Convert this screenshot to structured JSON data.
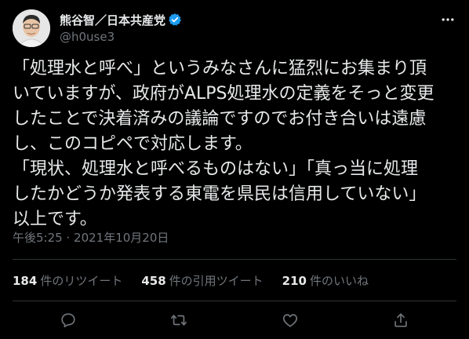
{
  "user": {
    "display_name": "熊谷智／日本共産党",
    "handle": "@h0use3"
  },
  "tweet": {
    "lines": [
      "「処理水と呼べ」というみなさんに猛烈にお集まり頂",
      "いていますが、政府がALPS処理水の定義をそっと変更",
      "したことで決着済みの議論ですのでお付き合いは遠慮",
      "し、このコピペで対応します。",
      "「現状、処理水と呼べるものはない」「真っ当に処理",
      "したかどうか発表する東電を県民は信用していない」",
      "以上です。"
    ],
    "time": "午後5:25",
    "separator": "·",
    "date": "2021年10月20日"
  },
  "stats": {
    "retweets_count": "184",
    "retweets_label": "件のリツイート",
    "quotes_count": "458",
    "quotes_label": "件の引用ツイート",
    "likes_count": "210",
    "likes_label": "件のいいね"
  },
  "colors": {
    "background": "#000000",
    "text": "#e7e9ea",
    "secondary": "#71767b",
    "verified": "#1d9bf0",
    "divider": "#2f3336"
  },
  "icons": [
    "verified-badge-icon",
    "more-icon",
    "reply-icon",
    "retweet-icon",
    "like-icon",
    "share-icon"
  ]
}
